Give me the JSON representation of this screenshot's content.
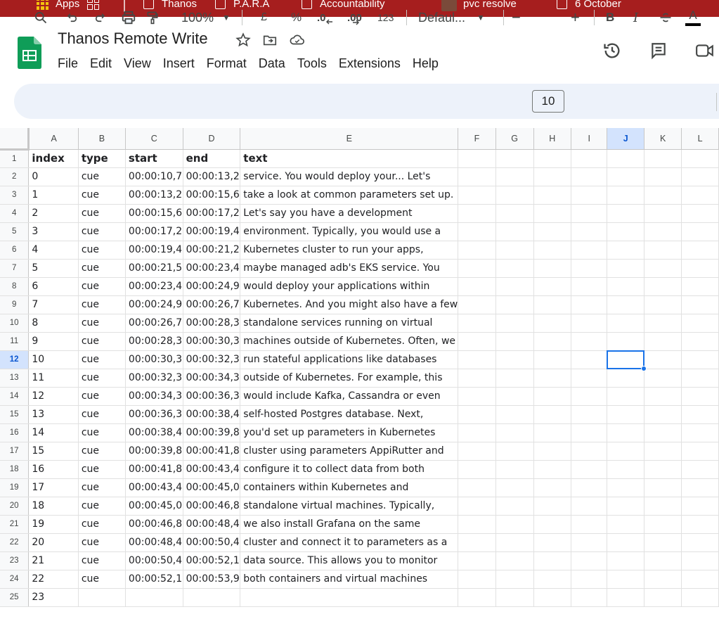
{
  "bookmarks": {
    "apps_label": "Apps",
    "items": [
      {
        "label": "Thanos"
      },
      {
        "label": "P.A.R.A"
      },
      {
        "label": "Accountability"
      },
      {
        "label": "pvc resolve"
      },
      {
        "label": "6 October"
      }
    ]
  },
  "document": {
    "title": "Thanos Remote Write"
  },
  "menu": {
    "items": [
      "File",
      "Edit",
      "View",
      "Insert",
      "Format",
      "Data",
      "Tools",
      "Extensions",
      "Help"
    ]
  },
  "toolbar": {
    "zoom": "100%",
    "currency": "£",
    "percent": "%",
    "decrease_decimal": ".0",
    "increase_decimal": ".00",
    "number_format": "123",
    "font": "Defaul...",
    "font_size": "10",
    "minus": "−",
    "plus": "+",
    "bold": "B",
    "italic": "I",
    "text_color": "A"
  },
  "grid": {
    "columns": [
      "A",
      "B",
      "C",
      "D",
      "E",
      "F",
      "G",
      "H",
      "I",
      "J",
      "K",
      "L"
    ],
    "selected_column": "J",
    "selected_row": 12,
    "header": {
      "index": "index",
      "type": "type",
      "start": "start",
      "end": "end",
      "text": "text"
    },
    "rows": [
      {
        "row": "2",
        "index": "0",
        "type": "cue",
        "start": "00:00:10,7",
        "end": "00:00:13,2",
        "text": "service. You would deploy your... Let's"
      },
      {
        "row": "3",
        "index": "1",
        "type": "cue",
        "start": "00:00:13,2",
        "end": "00:00:15,6",
        "text": "take a look at common parameters set up."
      },
      {
        "row": "4",
        "index": "2",
        "type": "cue",
        "start": "00:00:15,6",
        "end": "00:00:17,2",
        "text": "Let's say you have a development"
      },
      {
        "row": "5",
        "index": "3",
        "type": "cue",
        "start": "00:00:17,2",
        "end": "00:00:19,4",
        "text": "environment. Typically, you would use a"
      },
      {
        "row": "6",
        "index": "4",
        "type": "cue",
        "start": "00:00:19,4",
        "end": "00:00:21,2",
        "text": "Kubernetes cluster to run your apps,"
      },
      {
        "row": "7",
        "index": "5",
        "type": "cue",
        "start": "00:00:21,5",
        "end": "00:00:23,4",
        "text": "maybe managed adb's EKS service. You"
      },
      {
        "row": "8",
        "index": "6",
        "type": "cue",
        "start": "00:00:23,4",
        "end": "00:00:24,9",
        "text": "would deploy your applications within"
      },
      {
        "row": "9",
        "index": "7",
        "type": "cue",
        "start": "00:00:24,9",
        "end": "00:00:26,7",
        "text": "Kubernetes. And you might also have a few"
      },
      {
        "row": "10",
        "index": "8",
        "type": "cue",
        "start": "00:00:26,7",
        "end": "00:00:28,3",
        "text": "standalone services running on virtual"
      },
      {
        "row": "11",
        "index": "9",
        "type": "cue",
        "start": "00:00:28,3",
        "end": "00:00:30,3",
        "text": "machines outside of Kubernetes. Often, we"
      },
      {
        "row": "12",
        "index": "10",
        "type": "cue",
        "start": "00:00:30,3",
        "end": "00:00:32,3",
        "text": "run stateful applications like databases"
      },
      {
        "row": "13",
        "index": "11",
        "type": "cue",
        "start": "00:00:32,3",
        "end": "00:00:34,3",
        "text": "outside of Kubernetes. For example, this"
      },
      {
        "row": "14",
        "index": "12",
        "type": "cue",
        "start": "00:00:34,3",
        "end": "00:00:36,3",
        "text": "would include Kafka, Cassandra or even"
      },
      {
        "row": "15",
        "index": "13",
        "type": "cue",
        "start": "00:00:36,3",
        "end": "00:00:38,4",
        "text": "self-hosted Postgres database. Next,"
      },
      {
        "row": "16",
        "index": "14",
        "type": "cue",
        "start": "00:00:38,4",
        "end": "00:00:39,8",
        "text": "you'd set up parameters in Kubernetes"
      },
      {
        "row": "17",
        "index": "15",
        "type": "cue",
        "start": "00:00:39,8",
        "end": "00:00:41,8",
        "text": "cluster using parameters AppiRutter and"
      },
      {
        "row": "18",
        "index": "16",
        "type": "cue",
        "start": "00:00:41,8",
        "end": "00:00:43,4",
        "text": "configure it to collect data from both"
      },
      {
        "row": "19",
        "index": "17",
        "type": "cue",
        "start": "00:00:43,4",
        "end": "00:00:45,0",
        "text": "containers within Kubernetes and"
      },
      {
        "row": "20",
        "index": "18",
        "type": "cue",
        "start": "00:00:45,0",
        "end": "00:00:46,8",
        "text": "standalone virtual machines. Typically,"
      },
      {
        "row": "21",
        "index": "19",
        "type": "cue",
        "start": "00:00:46,8",
        "end": "00:00:48,4",
        "text": "we also install Grafana on the same"
      },
      {
        "row": "22",
        "index": "20",
        "type": "cue",
        "start": "00:00:48,4",
        "end": "00:00:50,4",
        "text": "cluster and connect it to parameters as a"
      },
      {
        "row": "23",
        "index": "21",
        "type": "cue",
        "start": "00:00:50,4",
        "end": "00:00:52,1",
        "text": "data source. This allows you to monitor"
      },
      {
        "row": "24",
        "index": "22",
        "type": "cue",
        "start": "00:00:52,1",
        "end": "00:00:53,9",
        "text": "both containers and virtual machines"
      },
      {
        "row": "25",
        "index": "23",
        "type": "",
        "start": "",
        "end": "",
        "text": ""
      }
    ]
  },
  "colors": {
    "bookmarks_bg": "#a61e1e",
    "toolbar_bg": "#edf2fa",
    "selection": "#1a73e8",
    "sheets_green": "#0f9d58"
  }
}
